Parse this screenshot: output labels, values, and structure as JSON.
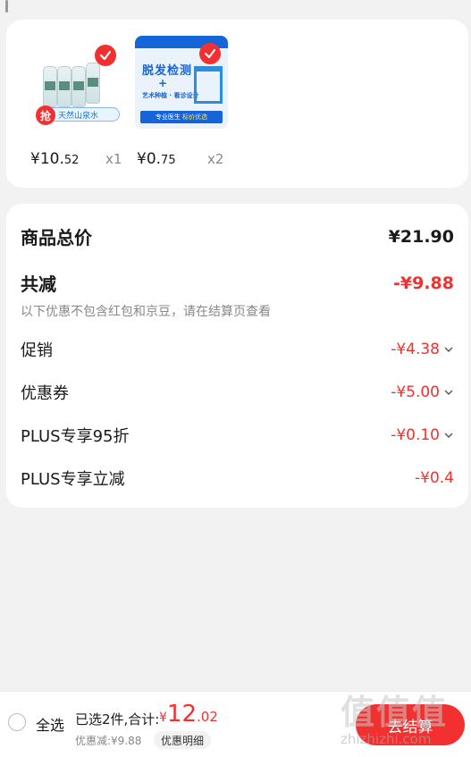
{
  "products": [
    {
      "name": "天然山泉水",
      "promo_badge": "抢",
      "promo_text": "天然山泉水",
      "price_main": "¥10.",
      "price_decimal": "52",
      "quantity": "x1"
    },
    {
      "name": "脱发检测",
      "ad_title": "脱发检测",
      "ad_plus": "+",
      "ad_sub": "艺术种植 · 看诊设计",
      "ad_bottom_prefix": "专业医生",
      "ad_bottom_highlight": "标价优选",
      "price_main": "¥0.",
      "price_decimal": "75",
      "quantity": "x2"
    }
  ],
  "summary": {
    "total_label": "商品总价",
    "total_value": "¥21.90",
    "reduction_label": "共减",
    "reduction_value": "-¥9.88",
    "note": "以下优惠不包含红包和京豆，请在结算页查看",
    "items": [
      {
        "label": "促销",
        "value": "-¥4.38",
        "has_chevron": true
      },
      {
        "label": "优惠券",
        "value": "-¥5.00",
        "has_chevron": true
      },
      {
        "label": "PLUS专享95折",
        "value": "-¥0.10",
        "has_chevron": true
      },
      {
        "label": "PLUS专享立减",
        "value": "-¥0.4",
        "has_chevron": false
      }
    ]
  },
  "bottom_bar": {
    "select_all": "全选",
    "selected_text": "已选2件,合计:",
    "total_symbol": "¥",
    "total_int": "12",
    "total_dec": ".02",
    "discount_text": "优惠减:¥9.88",
    "detail_button": "优惠明细",
    "checkout_button": "去结算"
  },
  "watermark": {
    "logo": "值值值",
    "text": "zhizhizhi.com"
  },
  "colors": {
    "accent_red": "#f23030",
    "background": "#f2f2f2",
    "muted": "#888888"
  }
}
